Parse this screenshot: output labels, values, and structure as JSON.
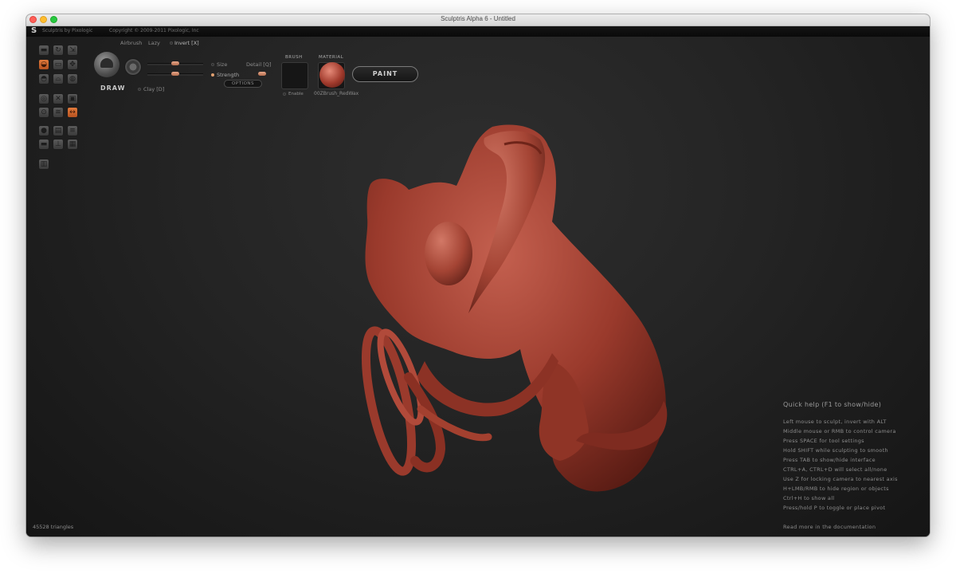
{
  "window": {
    "title": "Sculptris Alpha 6 - Untitled"
  },
  "header": {
    "brand": "Sculptris by Pixologic",
    "copyright": "Copyright © 2009-2011 Pixologic, Inc"
  },
  "tools": [
    {
      "name": "crease-tool",
      "glyph": "▬"
    },
    {
      "name": "rotate-tool",
      "glyph": "↻"
    },
    {
      "name": "scale-tool",
      "glyph": "⇲"
    },
    {
      "name": "draw-tool",
      "glyph": "◒"
    },
    {
      "name": "flatten-tool",
      "glyph": "▭"
    },
    {
      "name": "grab-tool",
      "glyph": "✥"
    },
    {
      "name": "inflate-tool",
      "glyph": "◓"
    },
    {
      "name": "pinch-tool",
      "glyph": "⌓"
    },
    {
      "name": "smooth-tool",
      "glyph": "◍"
    },
    {
      "name": "mask-tool",
      "glyph": "◎"
    },
    {
      "name": "reduce-tool",
      "glyph": "✕"
    },
    {
      "name": "paint-tool",
      "glyph": "▣"
    },
    {
      "name": "symmetry-tool",
      "glyph": "⊙"
    },
    {
      "name": "wireframe-tool",
      "glyph": "≋"
    },
    {
      "name": "sym-toggle-tool",
      "glyph": "↔"
    },
    {
      "name": "subdivide-tool",
      "glyph": "●"
    },
    {
      "name": "import-tool",
      "glyph": "▤"
    },
    {
      "name": "export-tool",
      "glyph": "≡"
    },
    {
      "name": "new-sphere-tool",
      "glyph": "▬"
    },
    {
      "name": "plane-tool",
      "glyph": "⊥"
    },
    {
      "name": "save-tool",
      "glyph": "▦"
    },
    {
      "name": "settings-tool",
      "glyph": "▥"
    }
  ],
  "brush": {
    "mode": "DRAW",
    "airbrush_label": "Airbrush",
    "lazy_label": "Lazy",
    "invert_label": "Invert [X]",
    "size_label": "Size",
    "strength_label": "Strength",
    "detail_label": "Detail [Q]",
    "clay_label": "Clay [D]",
    "options_label": "OPTIONS",
    "size_value": 0.5,
    "strength_value": 0.5
  },
  "brush_panel": {
    "header": "BRUSH",
    "enable_label": "Enable"
  },
  "material_panel": {
    "header": "MATERIAL",
    "name": "00ZBrush_RedWax",
    "color": "#a03a2c"
  },
  "paint_button": "PAINT",
  "help": {
    "title": "Quick help (F1 to show/hide)",
    "lines": [
      "Left mouse to sculpt, invert with ALT",
      "Middle mouse or RMB to control camera",
      "Press SPACE for tool settings",
      "Hold SHIFT while sculpting to smooth",
      "Press TAB to show/hide interface",
      "CTRL+A, CTRL+D will select all/none",
      "Use Z for locking camera to nearest axis",
      "H+LMB/RMB to hide region or objects",
      "Ctrl+H to show all",
      "Press/hold P to toggle or place pivot"
    ],
    "footer": "Read more in the documentation"
  },
  "status": {
    "triangles": "45528 triangles"
  }
}
